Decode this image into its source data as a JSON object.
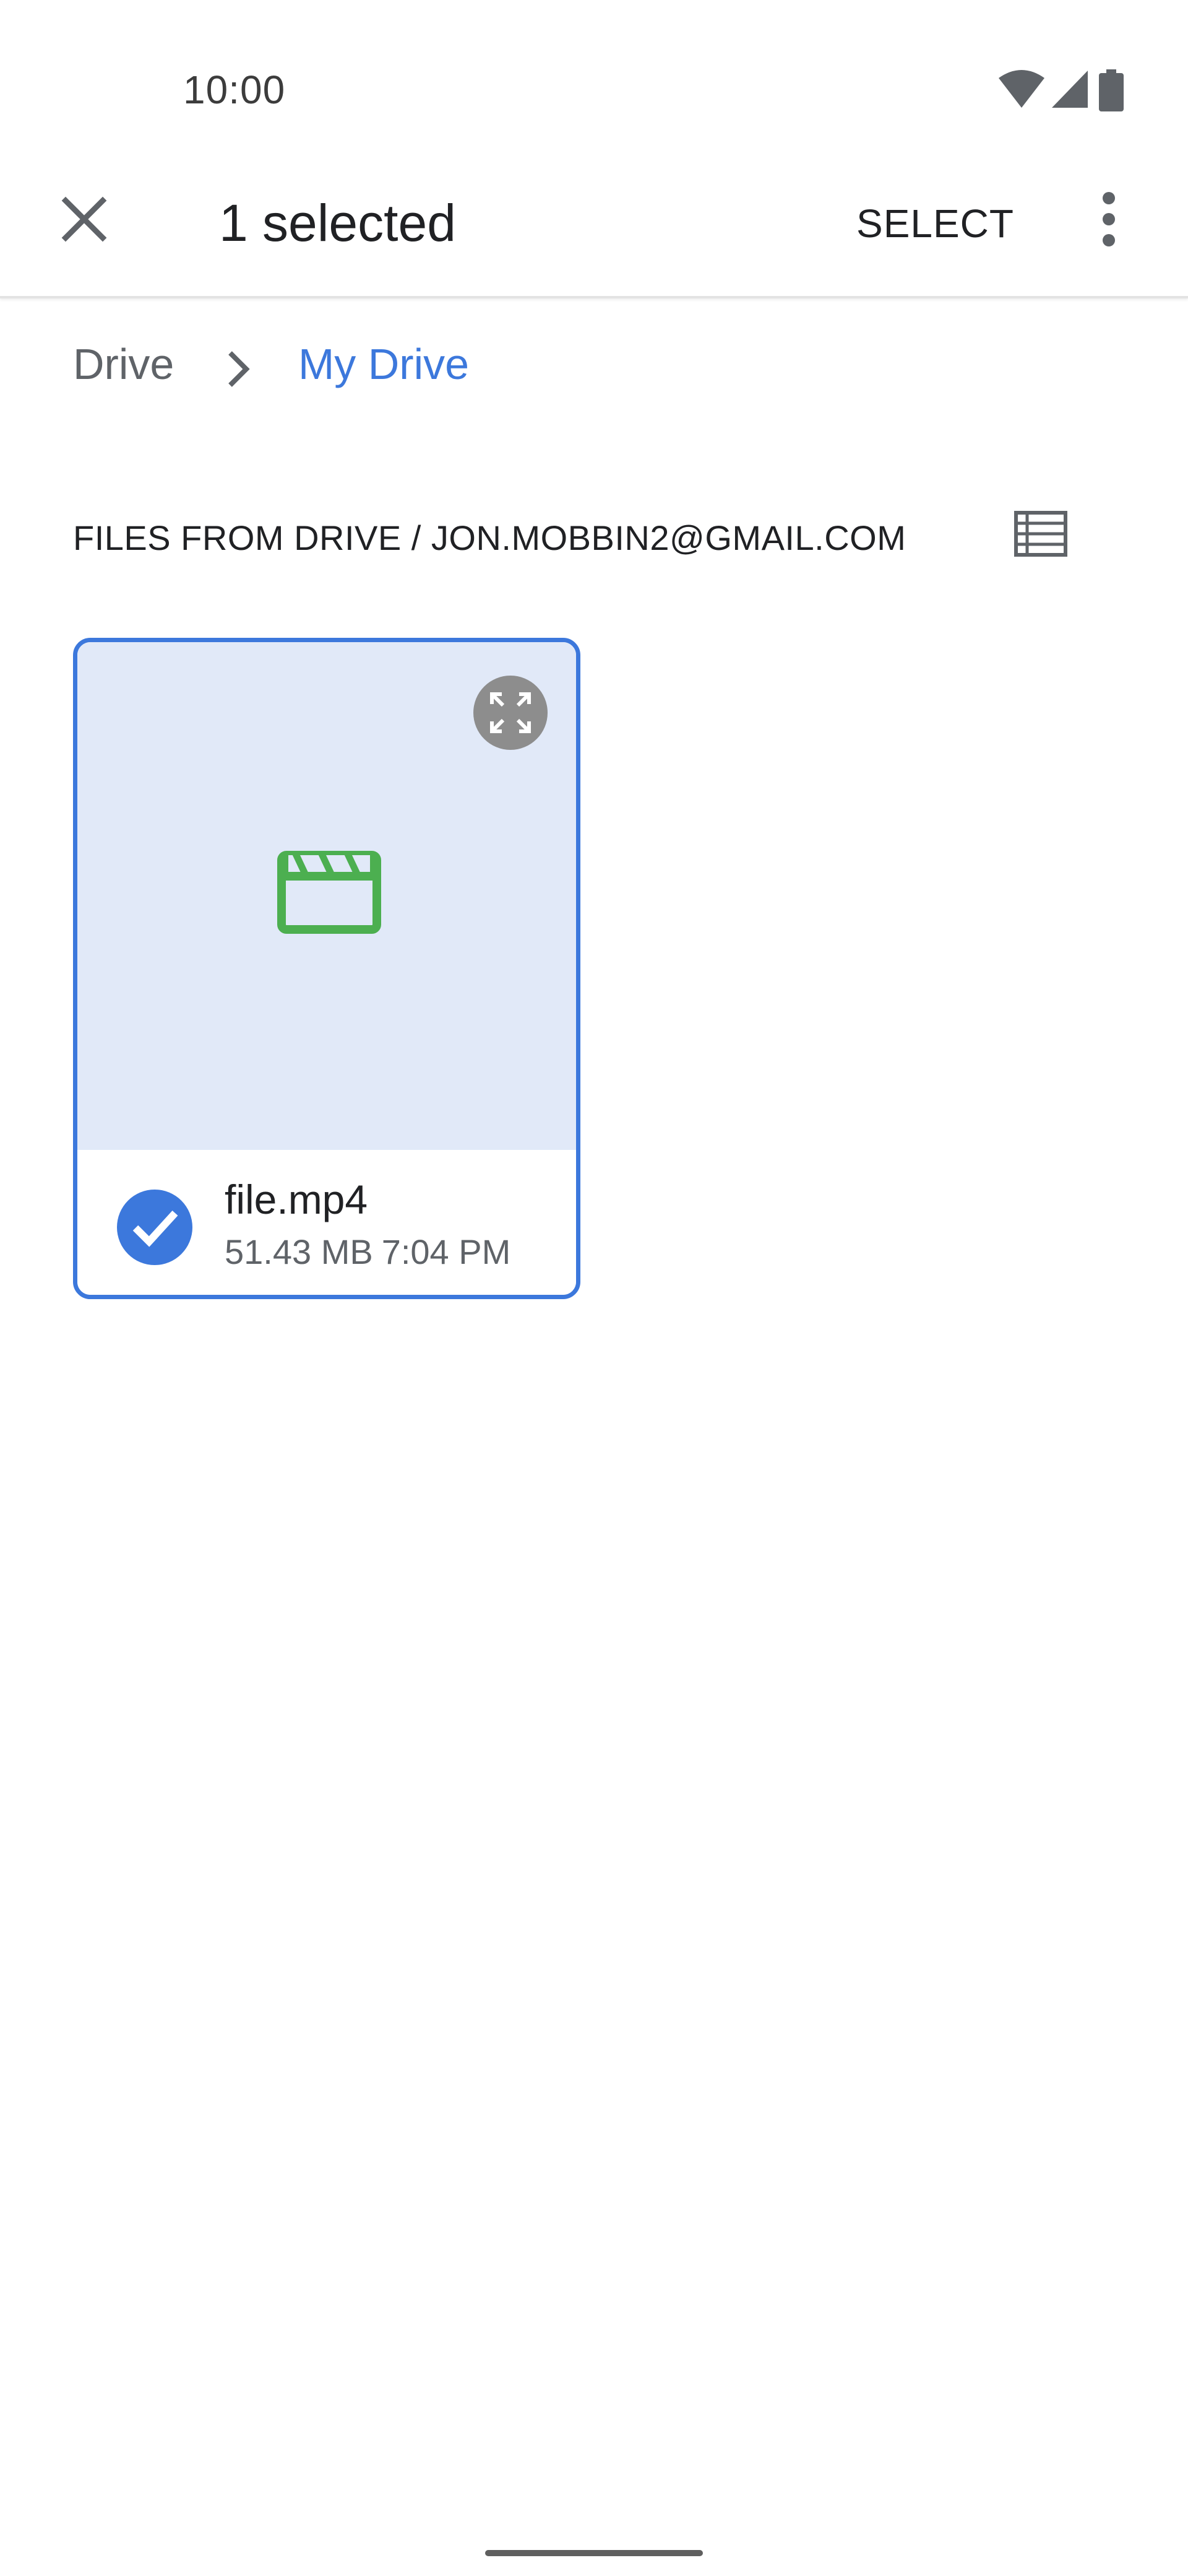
{
  "status_bar": {
    "time": "10:00",
    "icons": [
      "wifi-icon",
      "signal-icon",
      "battery-icon"
    ]
  },
  "app_bar": {
    "close_icon": "close-icon",
    "title": "1 selected",
    "select_label": "SELECT",
    "more_icon": "more-vert-icon"
  },
  "breadcrumb": {
    "root": "Drive",
    "separator_icon": "chevron-right-icon",
    "current": "My Drive"
  },
  "section": {
    "header": "FILES FROM DRIVE / JON.MOBBIN2@GMAIL.COM",
    "view_toggle_icon": "list-view-icon"
  },
  "files": [
    {
      "name": "file.mp4",
      "size": "51.43 MB",
      "time": "7:04 PM",
      "type_icon": "video-clapperboard-icon",
      "selected": true,
      "expand_icon": "fullscreen-icon"
    }
  ],
  "colors": {
    "accent": "#3c78dc",
    "preview_bg": "#e1e9f8",
    "video_icon": "#4caf50",
    "text_primary": "#202124",
    "text_secondary": "#5f6368"
  }
}
